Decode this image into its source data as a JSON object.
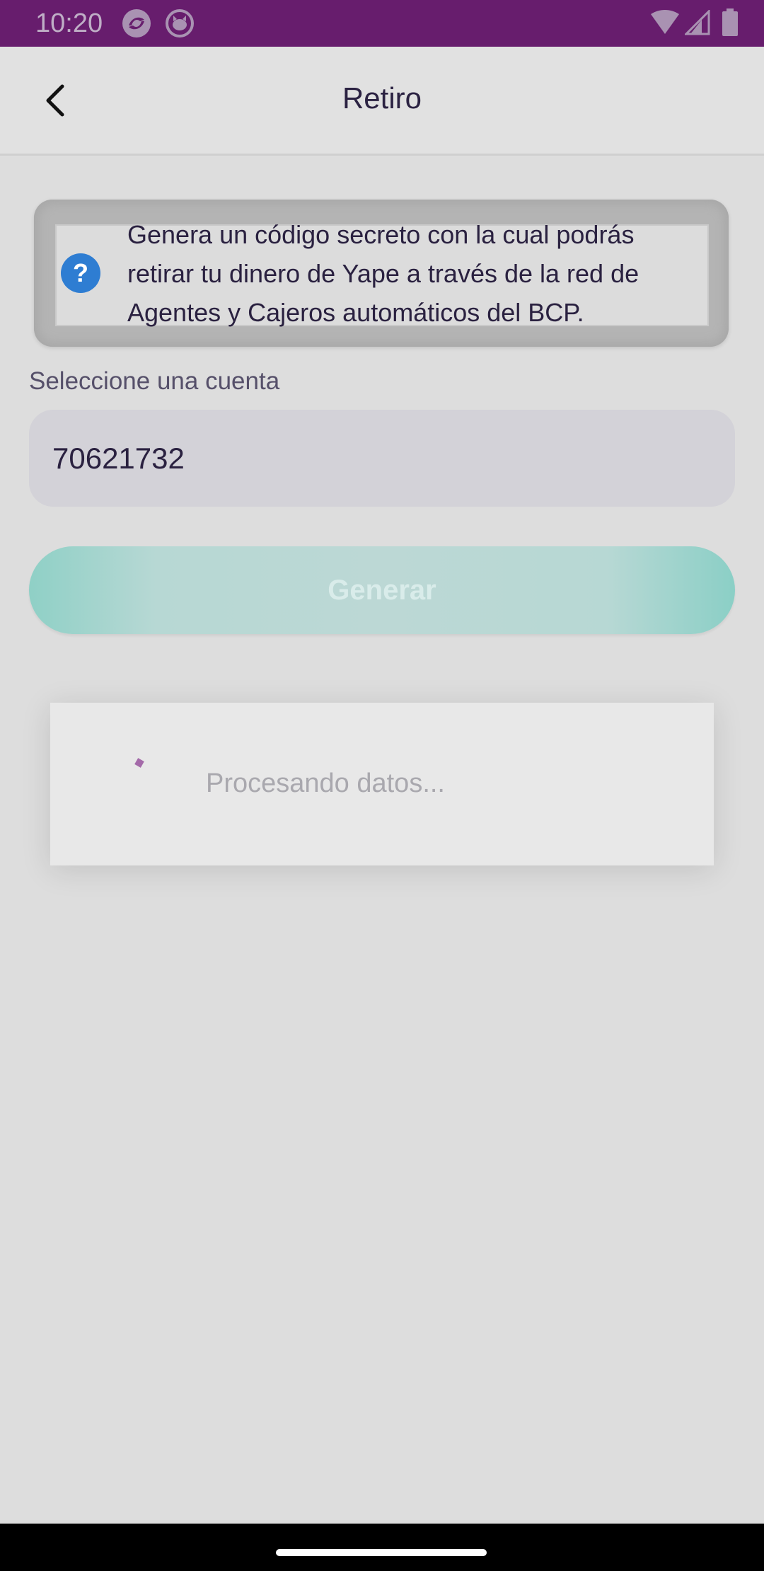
{
  "status_bar": {
    "time": "10:20",
    "icons": [
      "app-notification-icon",
      "github-notification-icon",
      "wifi-icon",
      "signal-icon",
      "battery-icon"
    ]
  },
  "app_bar": {
    "title": "Retiro",
    "back_icon": "chevron-left-icon"
  },
  "info": {
    "icon": "help-icon",
    "icon_glyph": "?",
    "text": "Genera un código secreto con la cual podrás retirar tu dinero de Yape a través de la red de Agentes y Cajeros automáticos del BCP."
  },
  "account": {
    "label": "Seleccione una cuenta",
    "selected_value": "70621732"
  },
  "actions": {
    "generate_label": "Generar"
  },
  "loading": {
    "text": "Procesando datos..."
  },
  "colors": {
    "status_bar": "#671d6d",
    "background": "#dddddd",
    "button_gradient_edge": "#8fd0c6",
    "help_icon": "#2e7dd2",
    "spinner": "#a46aa9"
  }
}
